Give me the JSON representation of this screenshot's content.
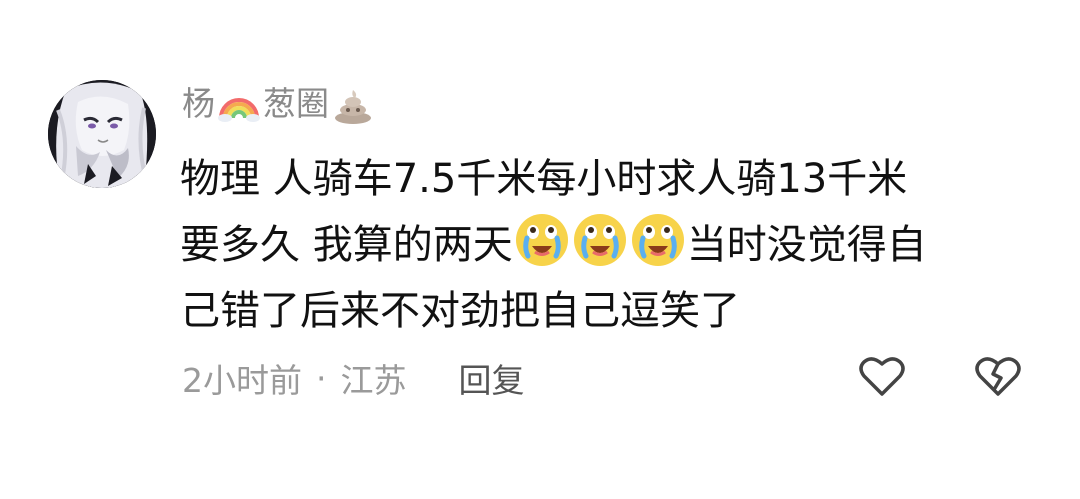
{
  "comment": {
    "username_part1": "杨",
    "username_emoji1": "rainbow-emoji",
    "username_part2": "葱圈",
    "username_emoji2": "poop-emoji",
    "avatar": "white-haired-anime-character",
    "text_line1": "物理  人骑车7.5千米每小时求人骑13千米",
    "text_line2_before": "要多久 我算的两天",
    "text_line2_emoji": "crying-laughing-face-emoji",
    "text_line2_after": "当时没觉得自",
    "text_line3": "己错了后来不对劲把自己逗笑了",
    "time": "2小时前",
    "separator": "·",
    "location": "江苏",
    "reply_label": "回复",
    "like_icon": "heart-outline-icon",
    "dislike_icon": "broken-heart-icon"
  },
  "colors": {
    "text_primary": "#111111",
    "text_secondary": "#9a9a9a",
    "icon": "#444444",
    "background": "#ffffff"
  }
}
